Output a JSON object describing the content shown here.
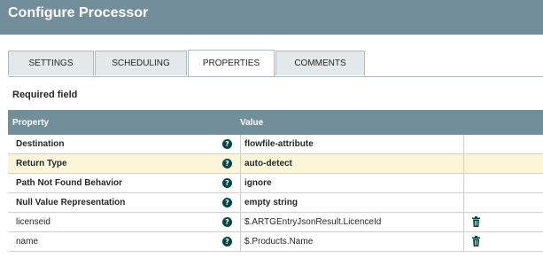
{
  "dialog": {
    "title": "Configure Processor"
  },
  "tabs": [
    {
      "label": "SETTINGS",
      "active": false
    },
    {
      "label": "SCHEDULING",
      "active": false
    },
    {
      "label": "PROPERTIES",
      "active": true
    },
    {
      "label": "COMMENTS",
      "active": false
    }
  ],
  "required_label": "Required field",
  "table": {
    "headers": {
      "property": "Property",
      "value": "Value"
    },
    "rows": [
      {
        "name": "Destination",
        "value": "flowfile-attribute",
        "required": true,
        "deletable": false
      },
      {
        "name": "Return Type",
        "value": "auto-detect",
        "required": true,
        "deletable": false
      },
      {
        "name": "Path Not Found Behavior",
        "value": "ignore",
        "required": true,
        "deletable": false
      },
      {
        "name": "Null Value Representation",
        "value": "empty string",
        "required": true,
        "deletable": false
      },
      {
        "name": "licenseid",
        "value": "$.ARTGEntryJsonResult.LicenceId",
        "required": false,
        "deletable": true
      },
      {
        "name": "name",
        "value": "$.Products.Name",
        "required": false,
        "deletable": true
      }
    ]
  },
  "icons": {
    "help": "help-icon",
    "delete": "trash-icon"
  },
  "colors": {
    "header": "#728e9b",
    "highlight_row": "#fbf6d8",
    "help_icon": "#004849"
  }
}
